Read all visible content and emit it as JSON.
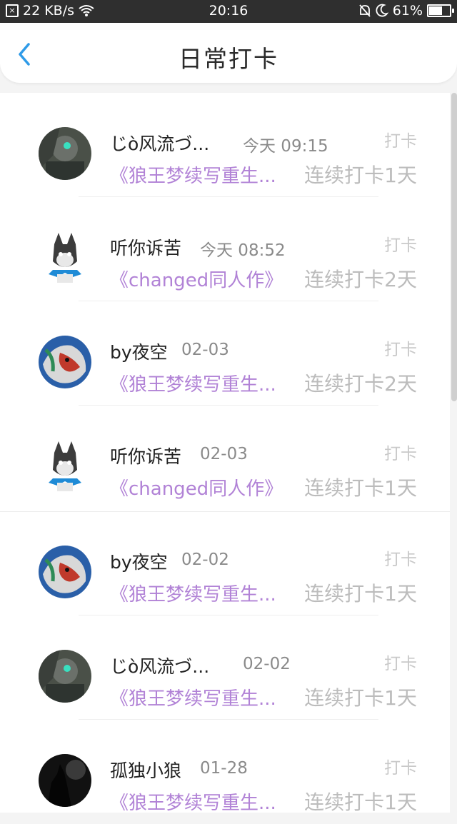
{
  "status": {
    "speed": "22 KB/s",
    "time": "20:16",
    "battery": "61%"
  },
  "header": {
    "title": "日常打卡"
  },
  "entries": [
    {
      "name": "じὸ风流づ...",
      "time": "今天 09:15",
      "action": "打卡",
      "book": "《狼王梦续写重生...",
      "streak": "连续打卡1天"
    },
    {
      "name": "听你诉苦",
      "time": "今天 08:52",
      "action": "打卡",
      "book": "《changed同人作》",
      "streak": "连续打卡2天"
    },
    {
      "name": "by夜空",
      "time": "02-03",
      "action": "打卡",
      "book": "《狼王梦续写重生...",
      "streak": "连续打卡2天"
    },
    {
      "name": "听你诉苦",
      "time": "02-03",
      "action": "打卡",
      "book": "《changed同人作》",
      "streak": "连续打卡1天"
    },
    {
      "name": "by夜空",
      "time": "02-02",
      "action": "打卡",
      "book": "《狼王梦续写重生...",
      "streak": "连续打卡1天"
    },
    {
      "name": "じὸ风流づ...",
      "time": "02-02",
      "action": "打卡",
      "book": "《狼王梦续写重生...",
      "streak": "连续打卡1天"
    },
    {
      "name": "孤独小狼",
      "time": "01-28",
      "action": "打卡",
      "book": "《狼王梦续写重生...",
      "streak": "连续打卡1天"
    }
  ],
  "icons": {
    "back": "chevron-left-icon"
  },
  "colors": {
    "book_link": "#b182d6",
    "back_arrow": "#2f9be8"
  }
}
